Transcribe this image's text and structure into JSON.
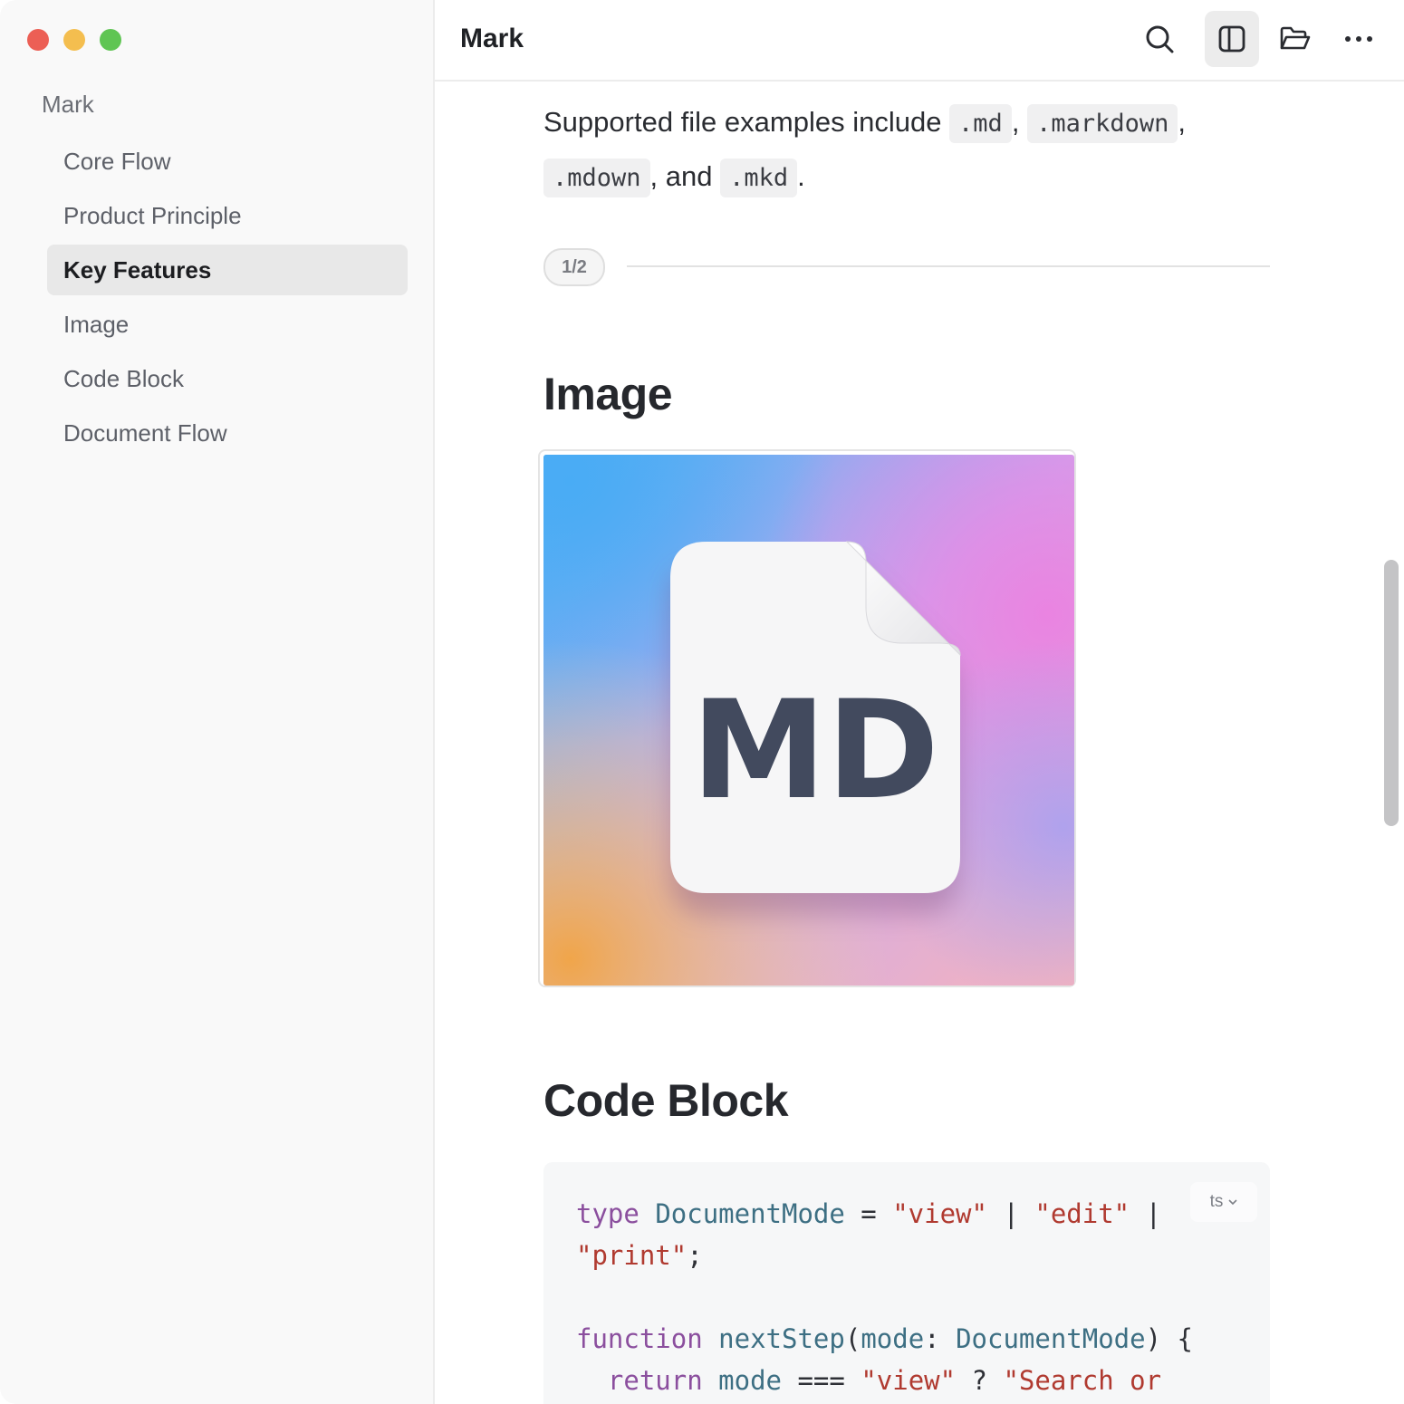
{
  "sidebar": {
    "root_label": "Mark",
    "items": [
      {
        "label": "Core Flow"
      },
      {
        "label": "Product Principle"
      },
      {
        "label": "Key Features",
        "active": true
      },
      {
        "label": "Image"
      },
      {
        "label": "Code Block"
      },
      {
        "label": "Document Flow"
      }
    ]
  },
  "toolbar": {
    "title": "Mark",
    "icons": [
      "search-icon",
      "sidebar-toggle-icon",
      "folder-open-icon",
      "more-icon"
    ]
  },
  "content": {
    "para_text_1": "Supported file examples include ",
    "ext_md": ".md",
    "sep_1": ", ",
    "ext_markdown": ".markdown",
    "sep_2": ",",
    "ext_mdown": ".mdown",
    "sep_3": ", and ",
    "ext_mkd": ".mkd",
    "para_end": ".",
    "page_badge": "1/2",
    "heading_image": "Image",
    "image_text": "MD",
    "heading_code": "Code Block",
    "code_lang": "ts",
    "code": {
      "l1_kw": "type",
      "l1_ty": "DocumentMode",
      "l1_eq": " = ",
      "l1_s1": "\"view\"",
      "l1_p1": " | ",
      "l1_s2": "\"edit\"",
      "l1_p2": " |",
      "l2_s": "\"print\"",
      "l2_end": ";",
      "l4_kw": "function",
      "l4_fn": "nextStep",
      "l4_p1": "(",
      "l4_param": "mode",
      "l4_colon": ": ",
      "l4_ty": "DocumentMode",
      "l4_p2": ") {",
      "l5_kw": "return",
      "l5_var": "mode",
      "l5_op": " === ",
      "l5_s1": "\"view\"",
      "l5_q": " ? ",
      "l5_s2": "\"Search or"
    }
  },
  "colors": {
    "keyword": "#8b4f9e",
    "type": "#3d6f83",
    "string": "#b03a30",
    "traffic_red": "#ec5f55",
    "traffic_yellow": "#f4be4f",
    "traffic_green": "#5fc553"
  }
}
